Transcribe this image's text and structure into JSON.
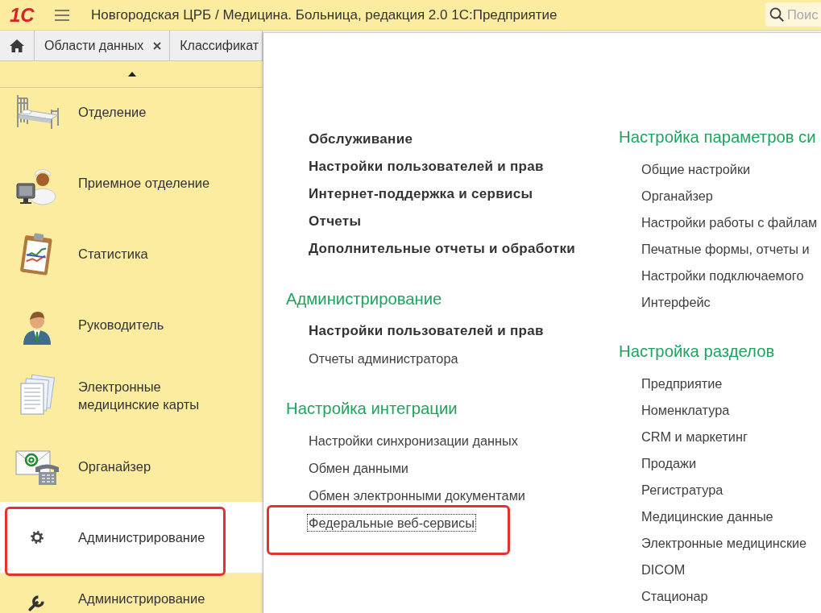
{
  "header": {
    "logo": "1С",
    "title": "Новгородская ЦРБ / Медицина. Больница, редакция 2.0 1С:Предприятие",
    "search": {
      "placeholder": "Поис"
    }
  },
  "tabs": [
    {
      "kind": "home"
    },
    {
      "kind": "page",
      "label": "Области данных",
      "closable": true
    },
    {
      "kind": "page",
      "label": "Классификат",
      "closable": false
    }
  ],
  "sidebar": {
    "items": [
      {
        "label": "Отделение",
        "selected": false,
        "highlighted": false
      },
      {
        "label": "Приемное отделение",
        "selected": false,
        "highlighted": false
      },
      {
        "label": "Статистика",
        "selected": false,
        "highlighted": false
      },
      {
        "label": "Руководитель",
        "selected": false,
        "highlighted": false
      },
      {
        "label": "Электронные медицинские карты",
        "selected": false,
        "highlighted": false
      },
      {
        "label": "Органайзер",
        "selected": false,
        "highlighted": false
      },
      {
        "label": "Администрирование",
        "selected": true,
        "highlighted": true
      },
      {
        "label": "Администрирование",
        "selected": false,
        "highlighted": false
      }
    ]
  },
  "menu": {
    "columns": [
      {
        "sections": [
          {
            "items": [
              {
                "label": "Обслуживание",
                "bold": true,
                "focused": false,
                "highlighted": false
              },
              {
                "label": "Настройки пользователей и прав",
                "bold": true,
                "focused": false,
                "highlighted": false
              },
              {
                "label": "Интернет-поддержка и сервисы",
                "bold": true,
                "focused": false,
                "highlighted": false
              },
              {
                "label": "Отчеты",
                "bold": true,
                "focused": false,
                "highlighted": false
              },
              {
                "label": "Дополнительные отчеты и обработки",
                "bold": true,
                "focused": false,
                "highlighted": false
              }
            ]
          },
          {
            "heading": "Администрирование",
            "items": [
              {
                "label": "Настройки пользователей и прав",
                "bold": true,
                "focused": false,
                "highlighted": false
              },
              {
                "label": "Отчеты администратора",
                "bold": false,
                "focused": false,
                "highlighted": false
              }
            ]
          },
          {
            "heading": "Настройка интеграции",
            "items": [
              {
                "label": "Настройки синхронизации данных",
                "bold": false,
                "focused": false,
                "highlighted": false
              },
              {
                "label": "Обмен данными",
                "bold": false,
                "focused": false,
                "highlighted": false
              },
              {
                "label": "Обмен электронными документами",
                "bold": false,
                "focused": false,
                "highlighted": false
              },
              {
                "label": "Федеральные веб-сервисы",
                "bold": false,
                "focused": true,
                "highlighted": true
              }
            ]
          }
        ]
      },
      {
        "sections": [
          {
            "heading": "Настройка параметров си",
            "items": [
              {
                "label": "Общие настройки",
                "bold": false,
                "focused": false,
                "highlighted": false
              },
              {
                "label": "Органайзер",
                "bold": false,
                "focused": false,
                "highlighted": false
              },
              {
                "label": "Настройки работы с файлам",
                "bold": false,
                "focused": false,
                "highlighted": false
              },
              {
                "label": "Печатные формы, отчеты и",
                "bold": false,
                "focused": false,
                "highlighted": false
              },
              {
                "label": "Настройки подключаемого",
                "bold": false,
                "focused": false,
                "highlighted": false
              },
              {
                "label": "Интерфейс",
                "bold": false,
                "focused": false,
                "highlighted": false
              }
            ]
          },
          {
            "heading": "Настройка разделов",
            "items": [
              {
                "label": "Предприятие",
                "bold": false,
                "focused": false,
                "highlighted": false
              },
              {
                "label": "Номенклатура",
                "bold": false,
                "focused": false,
                "highlighted": false
              },
              {
                "label": "CRM и маркетинг",
                "bold": false,
                "focused": false,
                "highlighted": false
              },
              {
                "label": "Продажи",
                "bold": false,
                "focused": false,
                "highlighted": false
              },
              {
                "label": "Регистратура",
                "bold": false,
                "focused": false,
                "highlighted": false
              },
              {
                "label": "Медицинские данные",
                "bold": false,
                "focused": false,
                "highlighted": false
              },
              {
                "label": "Электронные медицинские",
                "bold": false,
                "focused": false,
                "highlighted": false
              },
              {
                "label": "DICOM",
                "bold": false,
                "focused": false,
                "highlighted": false
              },
              {
                "label": "Стационар",
                "bold": false,
                "focused": false,
                "highlighted": false
              }
            ]
          }
        ]
      }
    ]
  }
}
